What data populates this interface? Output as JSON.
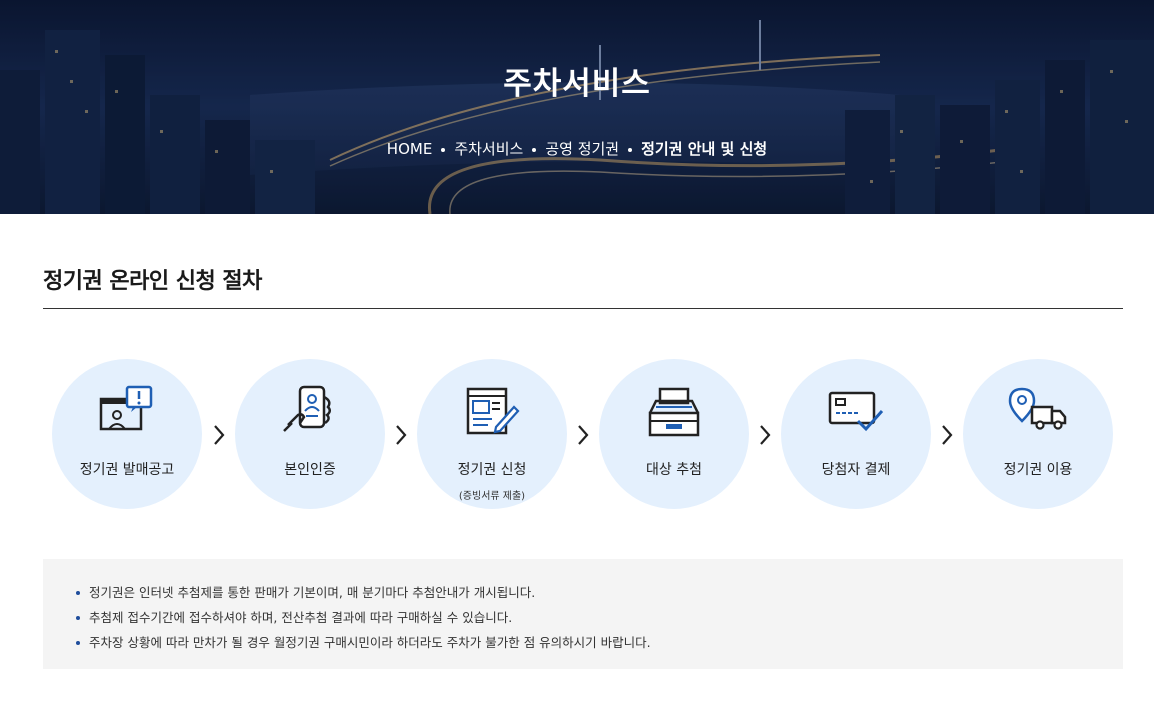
{
  "hero": {
    "title": "주차서비스",
    "breadcrumb": [
      "HOME",
      "주차서비스",
      "공영 정기권",
      "정기권 안내 및 신청"
    ]
  },
  "section": {
    "title": "정기권 온라인 신청 절차"
  },
  "steps": [
    {
      "label": "정기권 발매공고",
      "sublabel": "",
      "icon": "announcement-icon"
    },
    {
      "label": "본인인증",
      "sublabel": "",
      "icon": "mobile-verification-icon"
    },
    {
      "label": "정기권 신청",
      "sublabel": "(증빙서류 제출)",
      "icon": "application-form-icon"
    },
    {
      "label": "대상 추첨",
      "sublabel": "",
      "icon": "lottery-box-icon"
    },
    {
      "label": "당첨자 결제",
      "sublabel": "",
      "icon": "card-payment-icon"
    },
    {
      "label": "정기권 이용",
      "sublabel": "",
      "icon": "location-truck-icon"
    }
  ],
  "notice": [
    "정기권은 인터넷 추첨제를 통한 판매가 기본이며, 매 분기마다 추첨안내가 개시됩니다.",
    "추첨제 접수기간에 접수하셔야 하며, 전산추첨 결과에 따라 구매하실 수 있습니다.",
    "주차장 상황에 따라 만차가 될 경우 월정기권 구매시민이라 하더라도 주차가 불가한 점 유의하시기 바랍니다."
  ],
  "colors": {
    "hero_bg": "#14284c",
    "circle_bg": "#e4f0fd",
    "icon_dark": "#222222",
    "icon_accent": "#1f5fb4",
    "notice_bg": "#f4f4f4"
  }
}
